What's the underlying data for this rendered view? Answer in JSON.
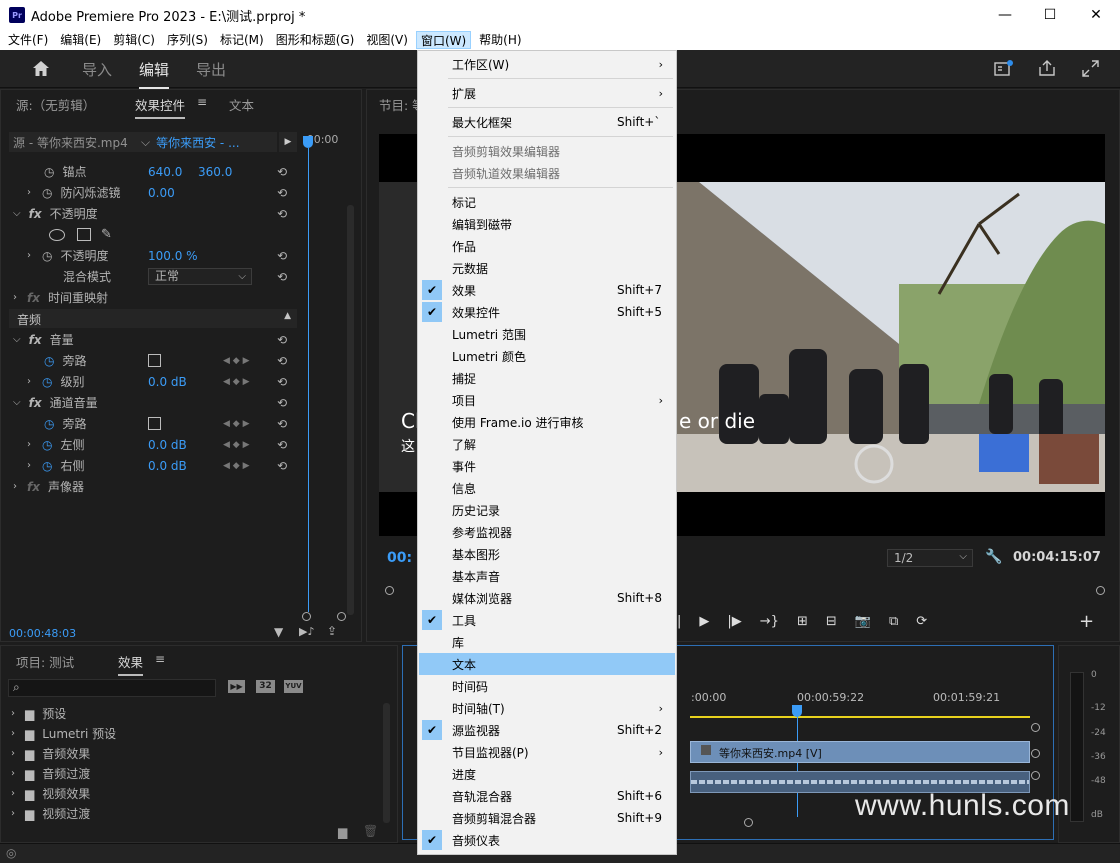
{
  "window": {
    "app_icon": "Pr",
    "title": "Adobe Premiere Pro 2023 - E:\\测试.prproj *",
    "minimize": "—",
    "maximize": "☐",
    "close": "✕"
  },
  "menubar": [
    "文件(F)",
    "编辑(E)",
    "剪辑(C)",
    "序列(S)",
    "标记(M)",
    "图形和标题(G)",
    "视图(V)",
    "窗口(W)",
    "帮助(H)"
  ],
  "topnav": {
    "tabs": [
      "导入",
      "编辑",
      "导出"
    ],
    "selected": "编辑"
  },
  "effect_controls": {
    "tabs": [
      "源:（无剪辑）",
      "效果控件",
      "文本"
    ],
    "selected_tab": "效果控件",
    "source_clip": "源 - 等你来西安.mp4",
    "sequence_clip": "等你来西安 - ...",
    "ruler_time": ":00:00",
    "rows": {
      "anchor_label": "锚点",
      "anchor_x": "640.0",
      "anchor_y": "360.0",
      "flicker_label": "防闪烁滤镜",
      "flicker_val": "0.00",
      "opacity_group": "不透明度",
      "opacity_label": "不透明度",
      "opacity_val": "100.0 %",
      "blend_label": "混合模式",
      "blend_val": "正常",
      "time_remap": "时间重映射",
      "audio_section": "音频",
      "volume_group": "音量",
      "bypass_label": "旁路",
      "level_label": "级别",
      "level_val": "0.0 dB",
      "channel_group": "通道音量",
      "bypass2_label": "旁路",
      "left_label": "左侧",
      "left_val": "0.0 dB",
      "right_label": "右侧",
      "right_val": "0.0 dB",
      "panner": "声像器"
    },
    "timecode": "00:00:48:03"
  },
  "program_monitor": {
    "title": "节目: 等你来西安",
    "subtitle_left": "Cl",
    "subtitle_right": "e or die",
    "subtitle_left2": "这",
    "timecode_left": "00:",
    "resolution": "1/2",
    "timecode_right": "00:04:15:07"
  },
  "project_panel": {
    "tabs": [
      "项目: 测试",
      "效果"
    ],
    "selected_tab": "效果",
    "badges": [
      "32",
      "YUV"
    ],
    "items": [
      "预设",
      "Lumetri 预设",
      "音频效果",
      "音频过渡",
      "视频效果",
      "视频过渡"
    ]
  },
  "timeline": {
    "times": [
      ":00:00",
      "00:00:59:22",
      "00:01:59:21"
    ],
    "clip_name": "等你来西安.mp4 [V]"
  },
  "audio_meter": {
    "labels": [
      "0",
      "-12",
      "-24",
      "-36",
      "-48",
      "dB"
    ]
  },
  "watermark": "www.hunls.com",
  "window_menu": {
    "items": [
      {
        "label": "工作区(W)",
        "submenu": true
      },
      {
        "label": "扩展",
        "submenu": true
      },
      {
        "label": "最大化框架",
        "shortcut": "Shift+`"
      },
      {
        "label": "音频剪辑效果编辑器",
        "disabled": true
      },
      {
        "label": "音频轨道效果编辑器",
        "disabled": true
      },
      {
        "label": "标记"
      },
      {
        "label": "编辑到磁带"
      },
      {
        "label": "作品"
      },
      {
        "label": "元数据"
      },
      {
        "label": "效果",
        "shortcut": "Shift+7",
        "checked": true
      },
      {
        "label": "效果控件",
        "shortcut": "Shift+5",
        "checked": true
      },
      {
        "label": "Lumetri 范围"
      },
      {
        "label": "Lumetri 颜色"
      },
      {
        "label": "捕捉"
      },
      {
        "label": "项目",
        "submenu": true
      },
      {
        "label": "使用 Frame.io 进行审核"
      },
      {
        "label": "了解"
      },
      {
        "label": "事件"
      },
      {
        "label": "信息"
      },
      {
        "label": "历史记录"
      },
      {
        "label": "参考监视器"
      },
      {
        "label": "基本图形"
      },
      {
        "label": "基本声音"
      },
      {
        "label": "媒体浏览器",
        "shortcut": "Shift+8"
      },
      {
        "label": "工具",
        "checked": true
      },
      {
        "label": "库"
      },
      {
        "label": "文本",
        "highlighted": true
      },
      {
        "label": "时间码"
      },
      {
        "label": "时间轴(T)",
        "submenu": true
      },
      {
        "label": "源监视器",
        "shortcut": "Shift+2",
        "checked": true
      },
      {
        "label": "节目监视器(P)",
        "submenu": true
      },
      {
        "label": "进度"
      },
      {
        "label": "音轨混合器",
        "shortcut": "Shift+6"
      },
      {
        "label": "音频剪辑混合器",
        "shortcut": "Shift+9"
      },
      {
        "label": "音频仪表",
        "checked": true
      }
    ]
  },
  "colors": {
    "accent_blue": "#3b9cf7",
    "menu_highlight": "#91c9f7",
    "timeline_yellow": "#e8d21d",
    "clip_blue": "#5b7fa8"
  }
}
